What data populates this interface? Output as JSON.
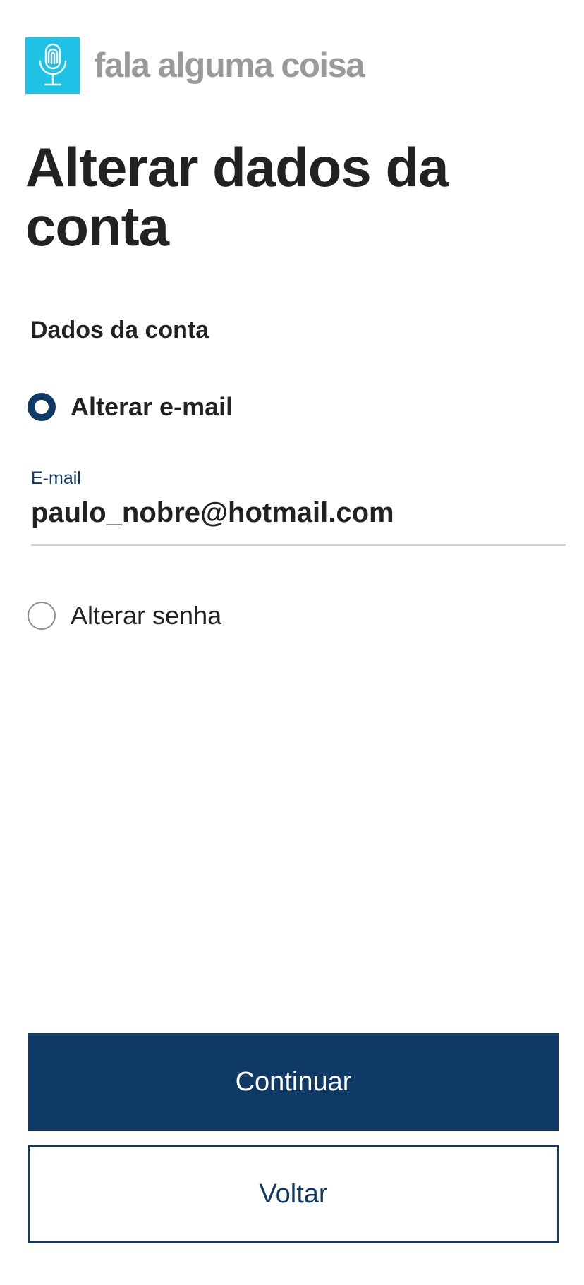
{
  "brand": {
    "name": "fala alguma coisa",
    "logo_icon": "microphone-fingerprint-icon",
    "logo_color": "#1ec2e6"
  },
  "page": {
    "title": "Alterar dados da conta"
  },
  "section": {
    "title": "Dados da conta"
  },
  "options": {
    "email": {
      "label": "Alterar e-mail",
      "selected": true
    },
    "password": {
      "label": "Alterar senha",
      "selected": false
    }
  },
  "email_field": {
    "label": "E-mail",
    "value": "paulo_nobre@hotmail.com"
  },
  "actions": {
    "continue_label": "Continuar",
    "back_label": "Voltar"
  },
  "colors": {
    "primary": "#0f3a65",
    "brand_text": "#9a9a9a",
    "text": "#222222"
  }
}
